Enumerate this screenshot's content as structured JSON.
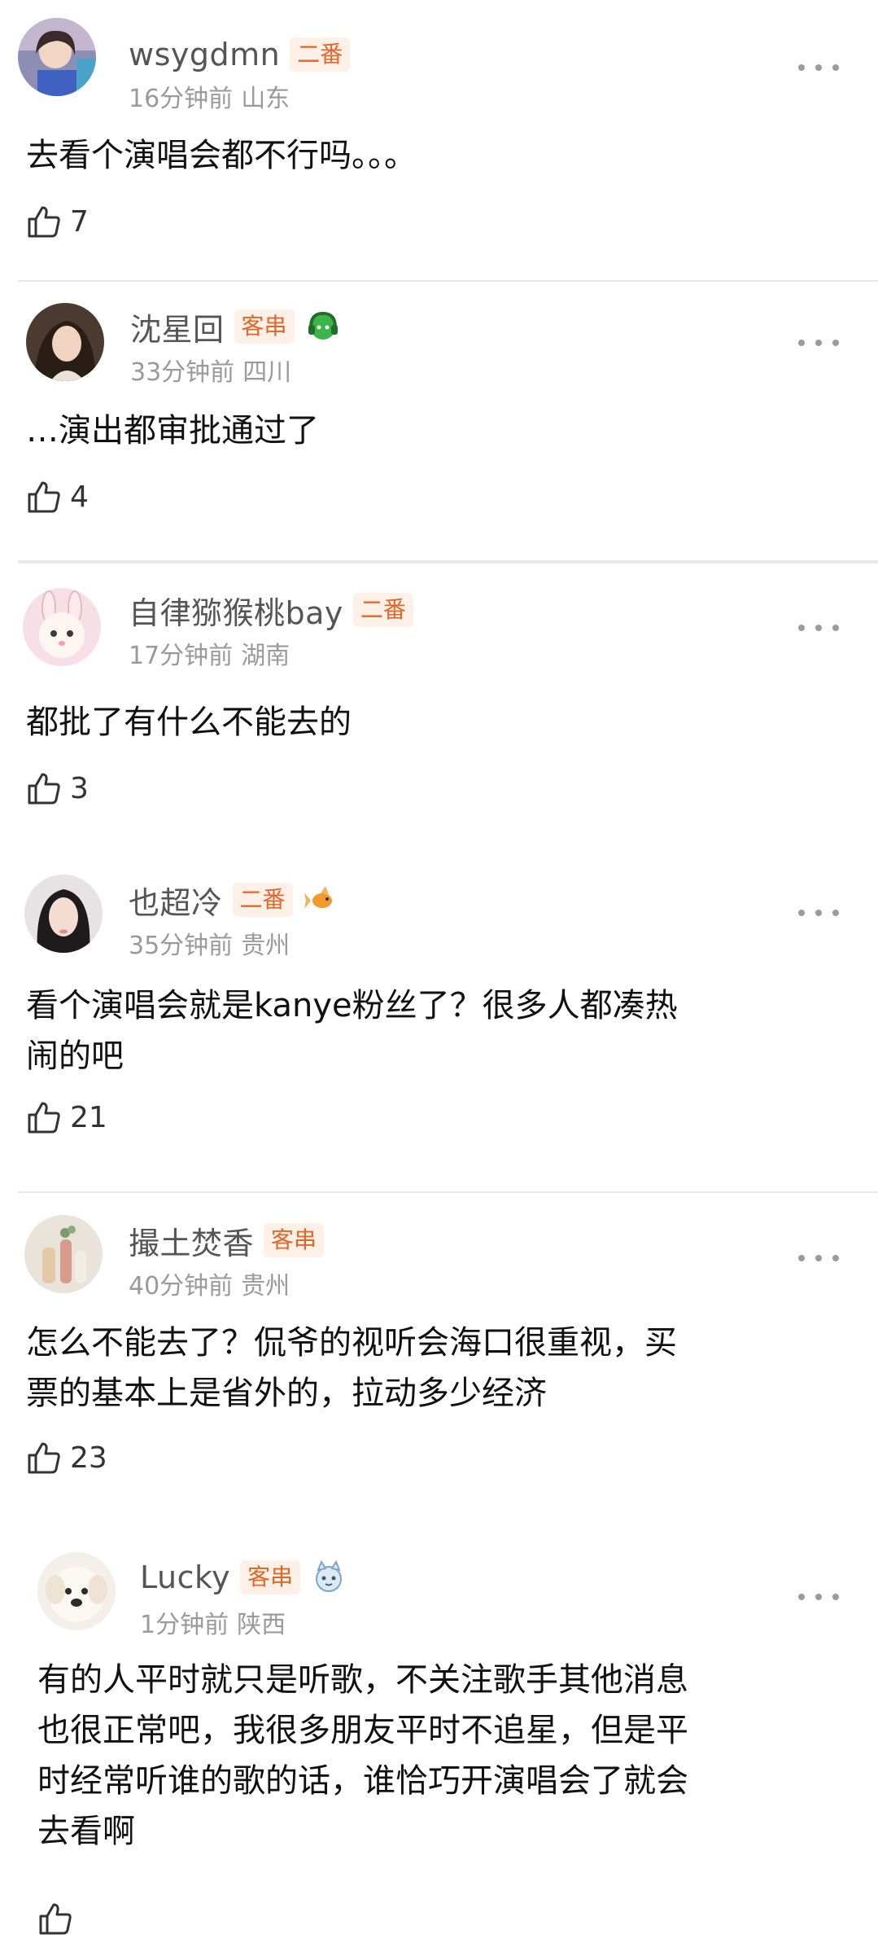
{
  "comments": [
    {
      "username": "wsygdmn",
      "badge": "二番",
      "time": "16分钟前",
      "location": "山东",
      "text": "去看个演唱会都不行吗。。。",
      "likes": "7",
      "avatar_icon": "avatar-girl-photo",
      "deco_icon": ""
    },
    {
      "username": "沈星回",
      "badge": "客串",
      "time": "33分钟前",
      "location": "四川",
      "text": "…演出都审批通过了",
      "likes": "4",
      "avatar_icon": "avatar-girl-photo",
      "deco_icon": "green-headphone-icon"
    },
    {
      "username": "自律猕猴桃bay",
      "badge": "二番",
      "time": "17分钟前",
      "location": "湖南",
      "text": "都批了有什么不能去的",
      "likes": "3",
      "avatar_icon": "avatar-bunny-cartoon",
      "deco_icon": ""
    },
    {
      "username": "也超冷",
      "badge": "二番",
      "time": "35分钟前",
      "location": "贵州",
      "text": "看个演唱会就是kanye粉丝了？很多人都凑热\n闹的吧",
      "likes": "21",
      "avatar_icon": "avatar-girl-photo",
      "deco_icon": "goldfish-icon"
    },
    {
      "username": "撮土焚香",
      "badge": "客串",
      "time": "40分钟前",
      "location": "贵州",
      "text": "怎么不能去了？侃爷的视听会海口很重视，买\n票的基本上是省外的，拉动多少经济",
      "likes": "23",
      "avatar_icon": "avatar-vase-photo",
      "deco_icon": ""
    },
    {
      "username": "Lucky",
      "badge": "客串",
      "time": "1分钟前",
      "location": "陕西",
      "text": "有的人平时就只是听歌，不关注歌手其他消息\n也很正常吧，我很多朋友平时不追星，但是平\n时经常听谁的歌的话，谁恰巧开演唱会了就会\n去看啊",
      "likes": "",
      "avatar_icon": "avatar-dog-photo",
      "deco_icon": "snow-cat-icon"
    }
  ],
  "colors": {
    "badge_text": "#e0672c",
    "badge_bg": "#fdf0e6",
    "username": "#555555",
    "meta": "#9a9a9a"
  }
}
